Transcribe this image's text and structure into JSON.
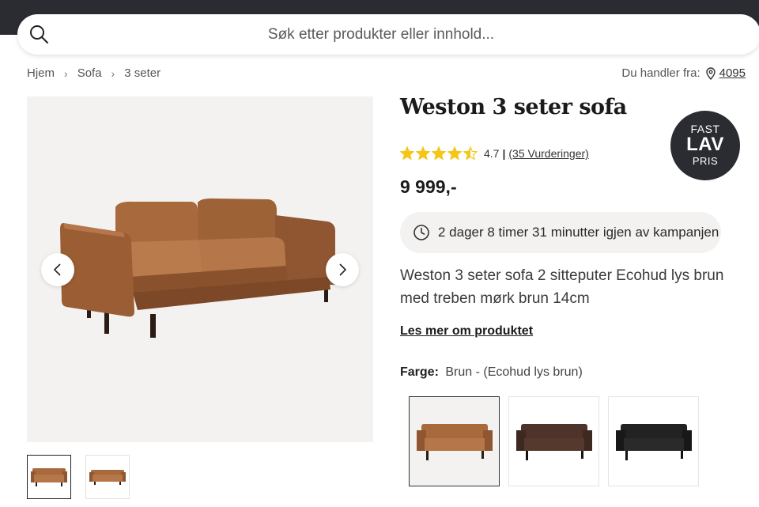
{
  "search": {
    "placeholder": "Søk etter produkter eller innhold..."
  },
  "breadcrumb": {
    "items": [
      "Hjem",
      "Sofa",
      "3 seter"
    ]
  },
  "location": {
    "label": "Du handler fra:",
    "zip": "4095"
  },
  "product": {
    "title": "Weston 3 seter sofa",
    "rating": {
      "score": "4.7",
      "reviews": "(35 Vurderinger)",
      "stars": 4.5,
      "max": 5
    },
    "price": "9 999,-",
    "countdown": "2 dager 8 timer 31 minutter igjen av kampanjen",
    "description": "Weston 3 seter sofa 2 sitteputer Ecohud lys brun med treben mørk brun 14cm",
    "read_more": "Les mer om produktet",
    "color_label": "Farge:",
    "color_value": "Brun - (Ecohud lys brun)"
  },
  "badge": {
    "line1": "FAST",
    "line2": "LAV",
    "line3": "PRIS"
  },
  "colors": {
    "topbar": "#2b2c31",
    "star": "#f5c518",
    "light_brown": "#a0653a",
    "dark_brown": "#4a3128",
    "black": "#1e1e1e"
  },
  "icons": [
    "search-icon",
    "chevron-right-icon",
    "location-pin-icon",
    "chevron-left-icon",
    "clock-icon",
    "star-icon"
  ]
}
